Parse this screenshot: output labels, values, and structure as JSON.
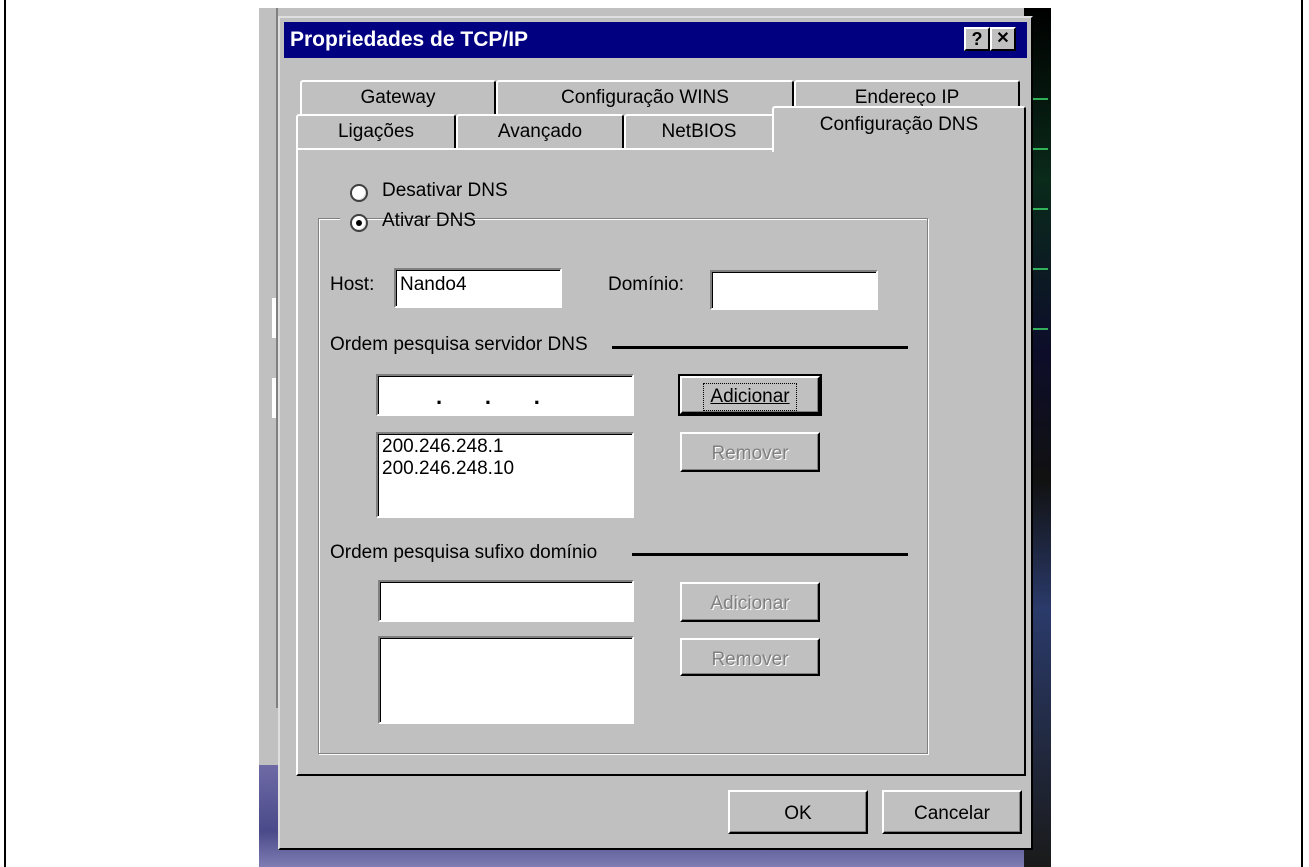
{
  "window": {
    "title": "Propriedades de TCP/IP",
    "help_label": "?",
    "close_label": "✕"
  },
  "tabs_back": [
    {
      "label": "Gateway"
    },
    {
      "label": "Configuração WINS"
    },
    {
      "label": "Endereço IP"
    }
  ],
  "tabs_front": [
    {
      "label": "Ligações"
    },
    {
      "label": "Avançado"
    },
    {
      "label": "NetBIOS"
    },
    {
      "label": "Configuração DNS"
    }
  ],
  "dns": {
    "disable_label": "Desativar DNS",
    "enable_label": "Ativar DNS",
    "selected": "enable",
    "host_label": "Host:",
    "host_value": "Nando4",
    "domain_label": "Domínio:",
    "domain_value": "",
    "server_order_label": "Ordem pesquisa servidor DNS",
    "server_ip_input": ".       .       .",
    "add_label": "Adicionar",
    "remove_label": "Remover",
    "servers": [
      "200.246.248.1",
      "200.246.248.10"
    ],
    "suffix_order_label": "Ordem pesquisa sufixo domínio",
    "suffix_input": "",
    "suffix_add_label": "Adicionar",
    "suffix_remove_label": "Remover",
    "suffixes": []
  },
  "footer": {
    "ok_label": "OK",
    "cancel_label": "Cancelar"
  },
  "colors": {
    "titlebar": "#000080",
    "face": "#c0c0c0"
  }
}
